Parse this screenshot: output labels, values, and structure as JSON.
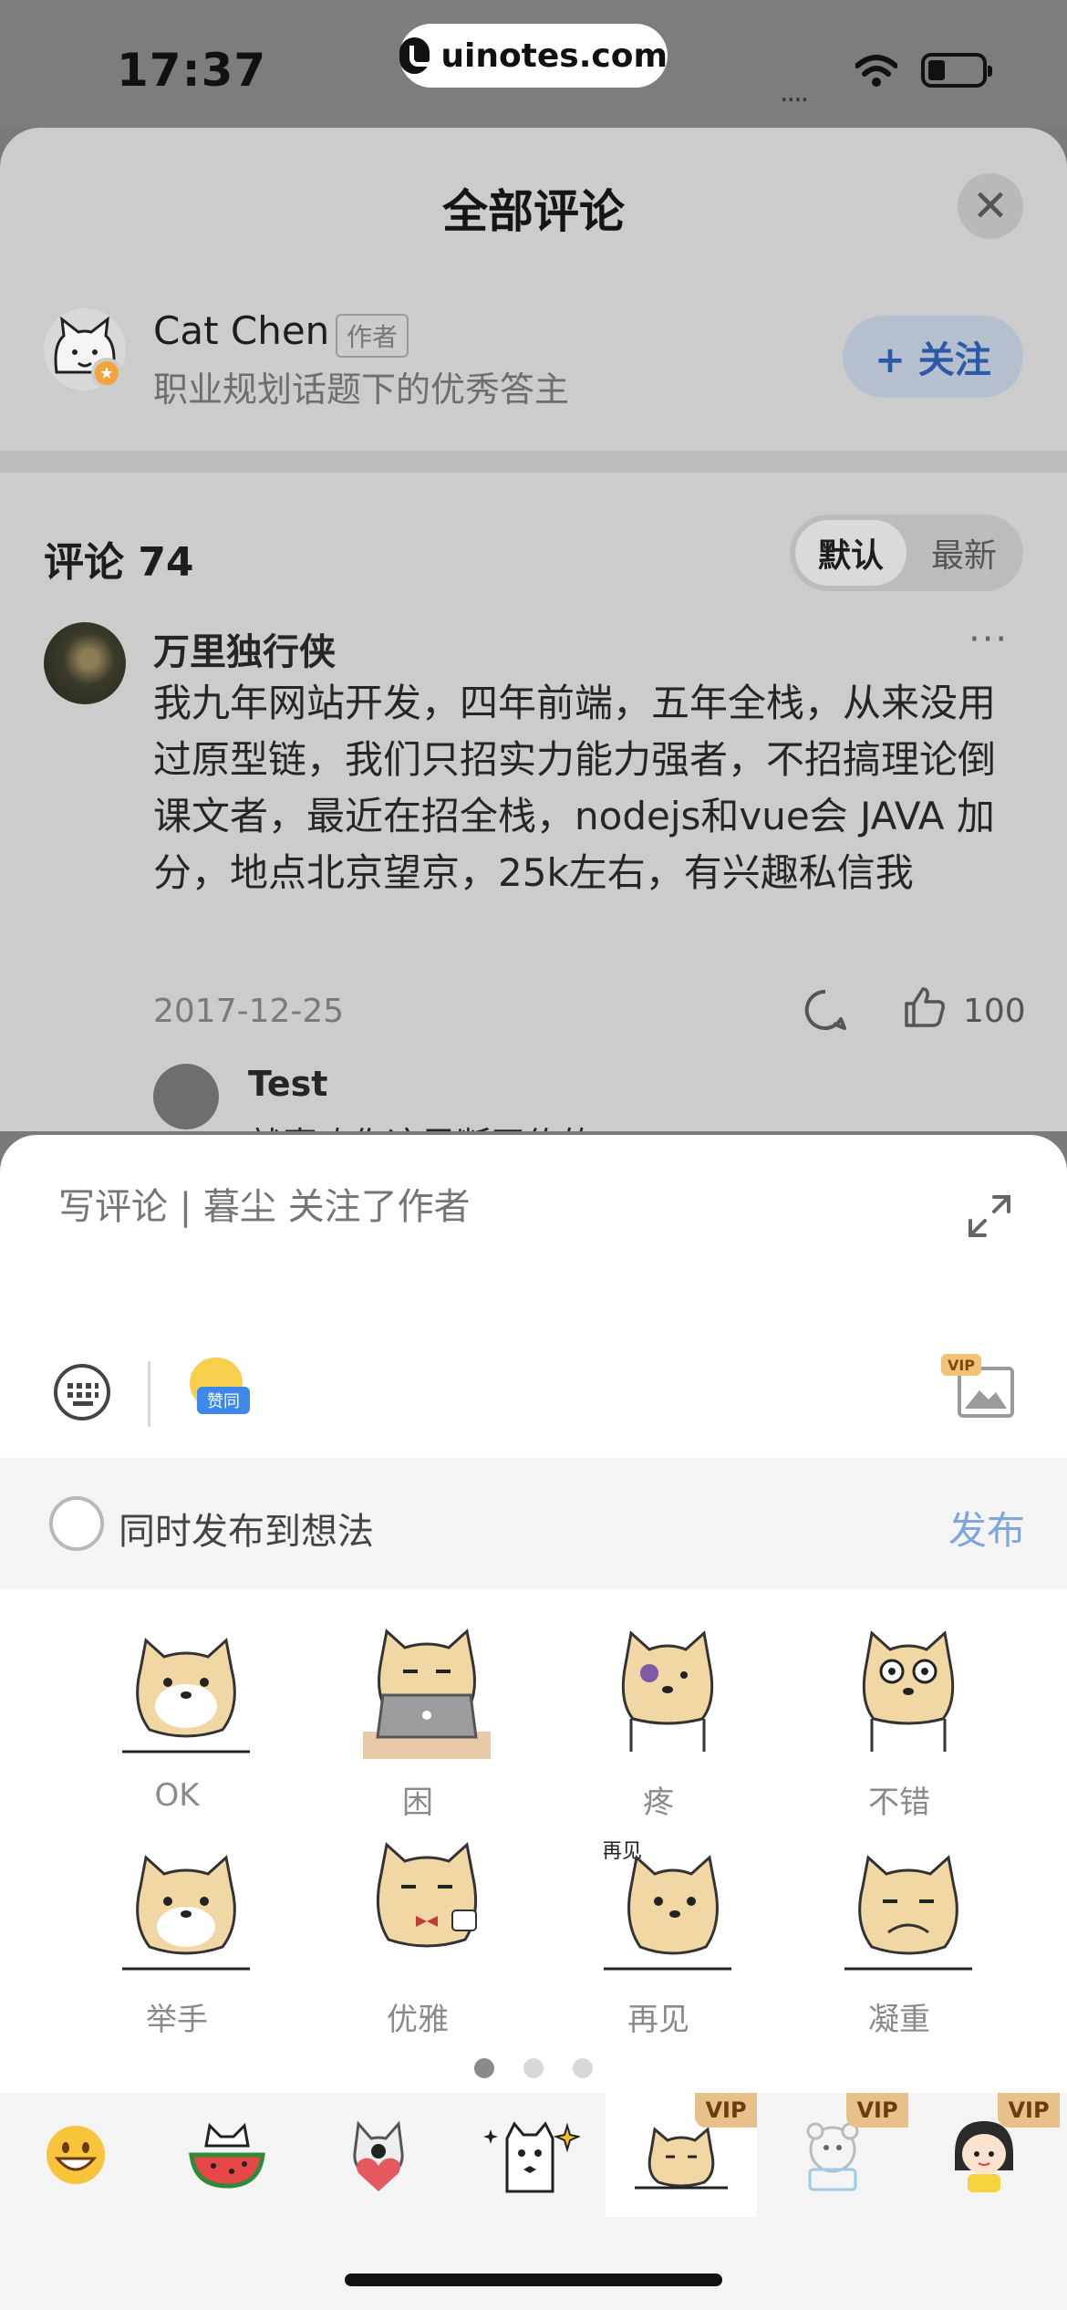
{
  "status_bar": {
    "time": "17:37",
    "site": "uinotes.com",
    "signal": "...."
  },
  "sheet": {
    "title": "全部评论",
    "close_glyph": "✕"
  },
  "author": {
    "name": "Cat Chen",
    "tag": "作者",
    "desc": "职业规划话题下的优秀答主",
    "follow_label": "+ 关注"
  },
  "comments_header": {
    "title": "评论 74",
    "sort_default": "默认",
    "sort_latest": "最新"
  },
  "comment": {
    "user": "万里独行侠",
    "more": "···",
    "body": "我九年网站开发，四年前端，五年全栈，从来没用过原型链，我们只招实力能力强者，不招搞理论倒课文者，最近在招全栈，nodejs和vue会 JAVA 加分，地点北京望京，25k左右，有兴趣私信我",
    "date": "2017-12-25",
    "likes": "100",
    "reply_user": "Test",
    "reply_text": "就喜欢你这思断玉传的"
  },
  "composer": {
    "placeholder": "写评论 | 暮尘 关注了作者",
    "zan_tag": "赞同",
    "vip": "VIP",
    "sync_label": "同时发布到想法",
    "publish_label": "发布"
  },
  "stickers": [
    {
      "label": "OK"
    },
    {
      "label": "困"
    },
    {
      "label": "疼"
    },
    {
      "label": "不错"
    },
    {
      "label": "举手"
    },
    {
      "label": "优雅"
    },
    {
      "label": "再见"
    },
    {
      "label": "凝重"
    }
  ],
  "sticker_text": {
    "zaijian": "再见"
  },
  "tabs": [
    {
      "icon": "grinning-emoji-icon",
      "vip": ""
    },
    {
      "icon": "watermelon-cat-icon",
      "vip": ""
    },
    {
      "icon": "heart-dog-icon",
      "vip": ""
    },
    {
      "icon": "sparkle-cat-icon",
      "vip": ""
    },
    {
      "icon": "shiba-pack-icon",
      "vip": "VIP"
    },
    {
      "icon": "bear-pack-icon",
      "vip": "VIP"
    },
    {
      "icon": "girl-pack-icon",
      "vip": "VIP"
    }
  ],
  "colors": {
    "accent": "#2b5aa8",
    "publish": "#7fa5dd",
    "shiba": "#f1d7a4",
    "vip": "#e7c08a"
  }
}
